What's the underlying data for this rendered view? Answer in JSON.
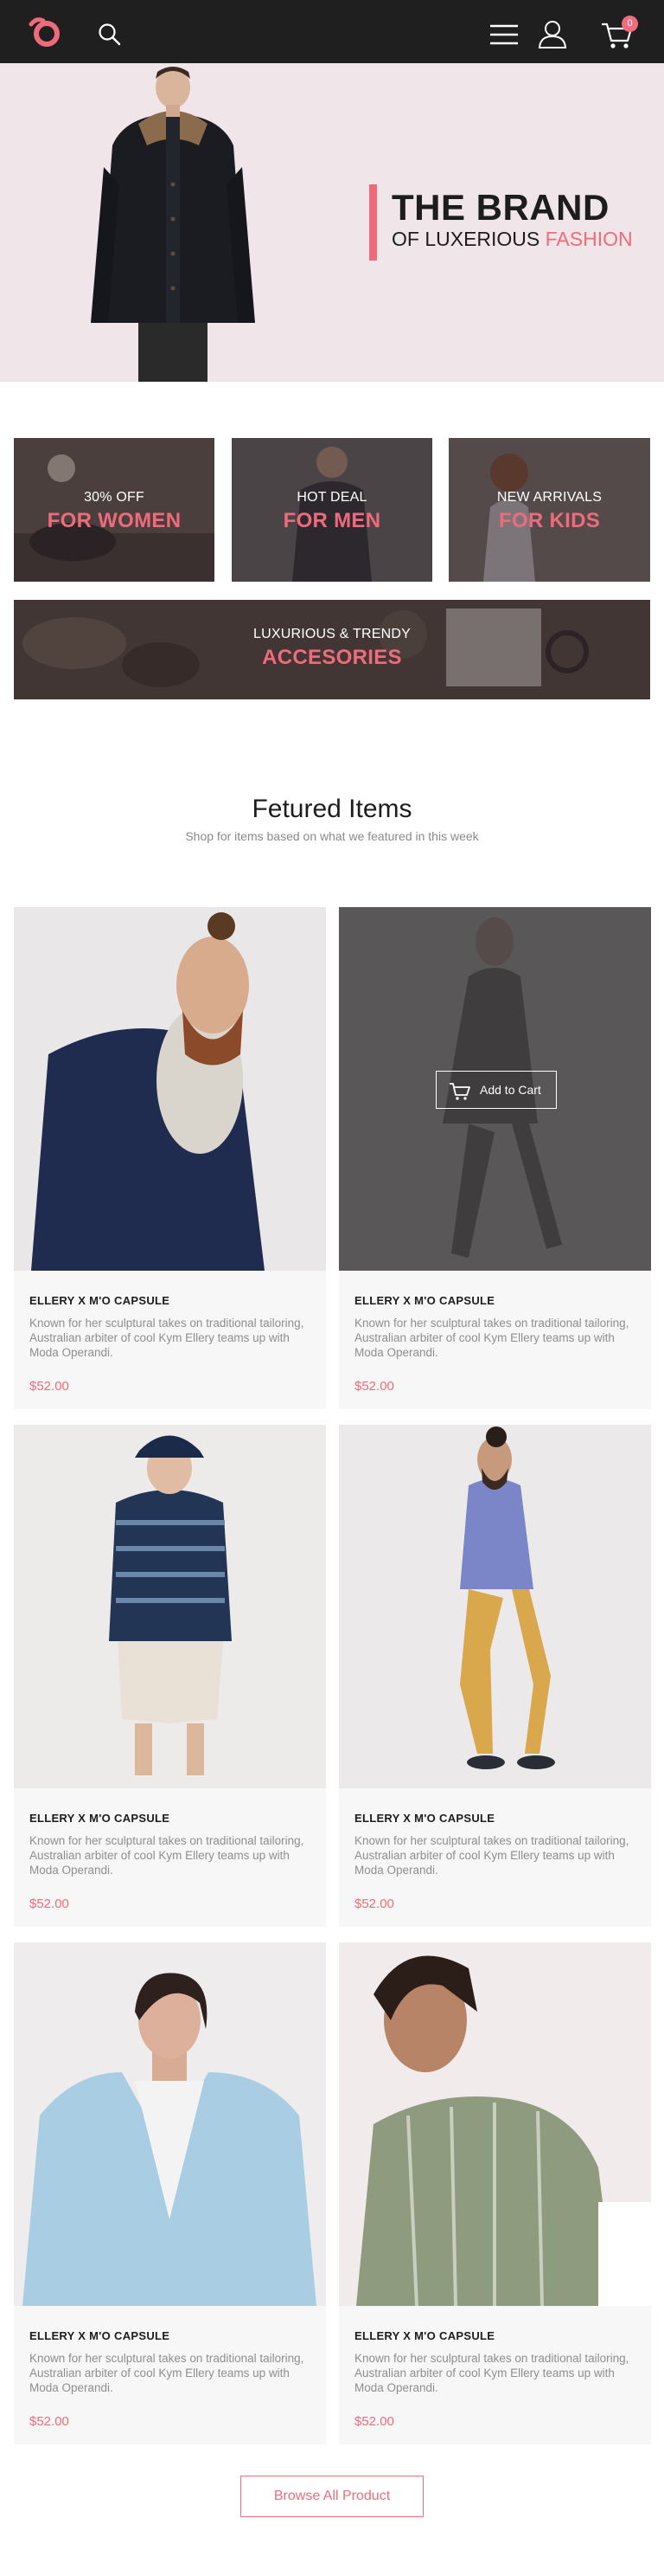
{
  "header": {
    "logo": "brand-logo",
    "icons": [
      "search-icon",
      "menu-icon",
      "user-icon",
      "cart-icon"
    ],
    "cart_count": "0"
  },
  "hero": {
    "title": "THE BRAND",
    "subtitle_prefix": "OF LUXERIOUS ",
    "subtitle_accent": "FASHION"
  },
  "categories": [
    {
      "top": "30% OFF",
      "main": "FOR WOMEN"
    },
    {
      "top": "HOT DEAL",
      "main": "FOR MEN"
    },
    {
      "top": "NEW ARRIVALS",
      "main": "FOR KIDS"
    },
    {
      "top": "LUXURIOUS & TRENDY",
      "main": "ACCESORIES"
    }
  ],
  "featured": {
    "title": "Fetured Items",
    "subtitle": "Shop for items based on what we featured in this week"
  },
  "products": [
    {
      "name": "ELLERY X M'O CAPSULE",
      "desc": "Known for her sculptural takes on traditional tailoring, Australian arbiter of cool Kym Ellery teams up with Moda Operandi.",
      "price": "$52.00"
    },
    {
      "name": "ELLERY X M'O CAPSULE",
      "desc": "Known for her sculptural takes on traditional tailoring, Australian arbiter of cool Kym Ellery teams up with Moda Operandi.",
      "price": "$52.00",
      "hover_action": "Add to Cart"
    },
    {
      "name": "ELLERY X M'O CAPSULE",
      "desc": "Known for her sculptural takes on traditional tailoring, Australian arbiter of cool Kym Ellery teams up with Moda Operandi.",
      "price": "$52.00"
    },
    {
      "name": "ELLERY X M'O CAPSULE",
      "desc": "Known for her sculptural takes on traditional tailoring, Australian arbiter of cool Kym Ellery teams up with Moda Operandi.",
      "price": "$52.00"
    },
    {
      "name": "ELLERY X M'O CAPSULE",
      "desc": "Known for her sculptural takes on traditional tailoring, Australian arbiter of cool Kym Ellery teams up with Moda Operandi.",
      "price": "$52.00"
    },
    {
      "name": "ELLERY X M'O CAPSULE",
      "desc": "Known for her sculptural takes on traditional tailoring, Australian arbiter of cool Kym Ellery teams up with Moda Operandi.",
      "price": "$52.00"
    }
  ],
  "browse_label": "Browse All Product",
  "colors": {
    "accent": "#ee6b7b",
    "header_bg": "#1f1f1f",
    "hero_bg": "#f0e6ea"
  }
}
